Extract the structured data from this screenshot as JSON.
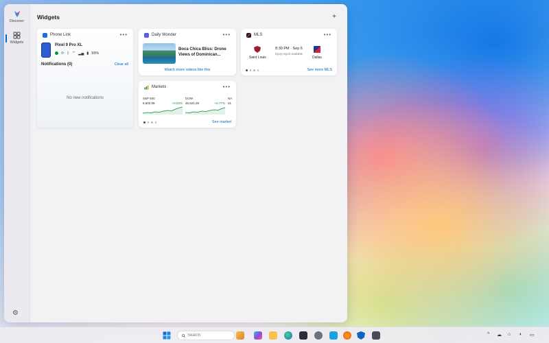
{
  "rail": {
    "items": [
      {
        "label": "Discover",
        "icon": "discover-icon"
      },
      {
        "label": "Widgets",
        "icon": "widgets-grid-icon"
      }
    ],
    "settings_icon": "gear-icon"
  },
  "panel": {
    "title": "Widgets",
    "add_label": "+"
  },
  "phone_link": {
    "name": "Phone Link",
    "device": "Pixel 9 Pro XL",
    "battery": "99%",
    "notifications_title": "Notifications (0)",
    "clear_all": "Clear all",
    "empty_text": "No new notifications",
    "more": "•••"
  },
  "daily_wonder": {
    "name": "Daily Wonder",
    "headline": "Boca Chica Bliss: Drone Views of Dominican...",
    "link": "Watch more videos like this",
    "more": "•••"
  },
  "mls": {
    "name": "MLS",
    "home_team": "Saint Louis",
    "away_team": "Dallas",
    "time": "8:30 PM · Sep 6",
    "subtext": "Injury report available",
    "see_more": "See more MLS",
    "more": "•••",
    "colors": {
      "home": "#9b1b30",
      "away": "#d5213d"
    }
  },
  "markets": {
    "name": "Markets",
    "items": [
      {
        "symbol": "S&P 500",
        "value": "6,502.08",
        "change": "+0.83%"
      },
      {
        "symbol": "DOW",
        "value": "45,621.29",
        "change": "+0.77%"
      },
      {
        "symbol": "NA",
        "value": "21",
        "change": ""
      }
    ],
    "see_more": "See market",
    "more": "•••"
  },
  "taskbar": {
    "search_placeholder": "Search",
    "start_icon": "windows-start-icon",
    "tray_chevron": "^"
  },
  "colors": {
    "accent": "#0067c0",
    "positive": "#0f8a3c"
  }
}
